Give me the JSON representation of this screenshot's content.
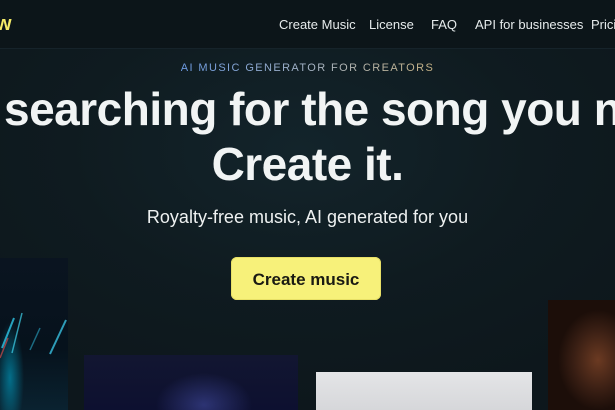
{
  "header": {
    "logo_text": "w",
    "nav": [
      {
        "label": "Create Music"
      },
      {
        "label": "License"
      },
      {
        "label": "FAQ"
      },
      {
        "label": "API for businesses"
      },
      {
        "label": "Prici"
      }
    ]
  },
  "hero": {
    "eyebrow": "AI MUSIC GENERATOR FOR CREATORS",
    "headline_line1": "searching for the song you n",
    "headline_line2": "Create it.",
    "subtitle": "Royalty-free music, AI generated for you",
    "cta_label": "Create music"
  },
  "colors": {
    "background": "#0f1a1f",
    "accent": "#f7f17a",
    "text": "#f1f4f4"
  }
}
